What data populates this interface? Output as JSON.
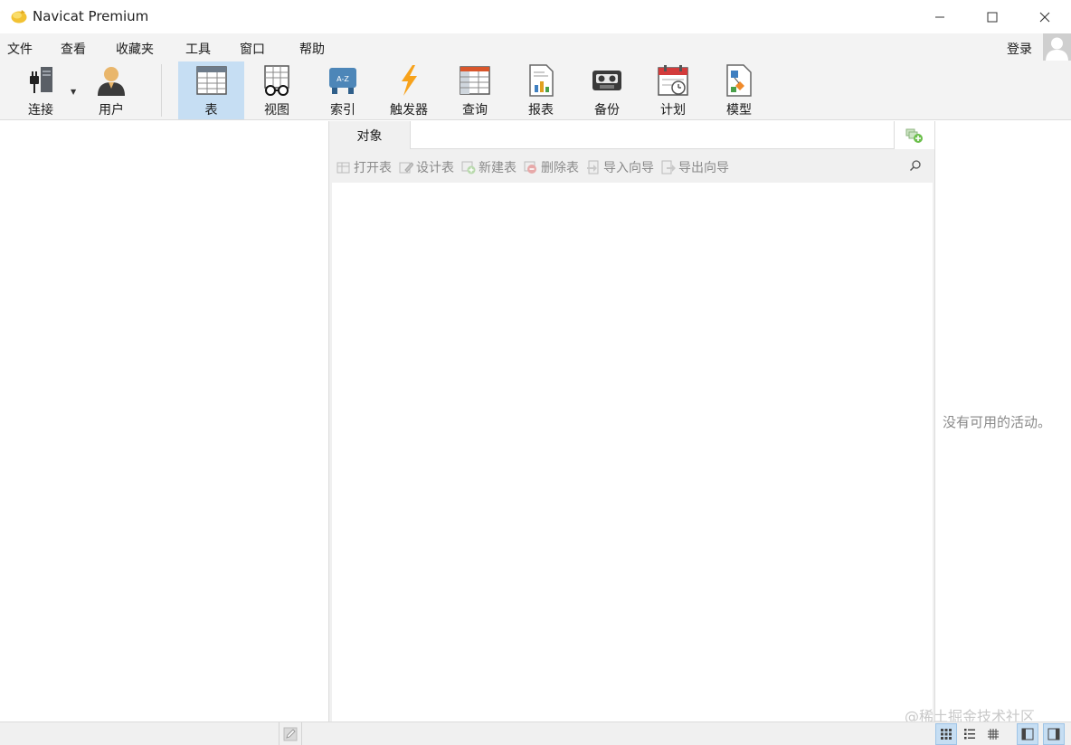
{
  "window": {
    "title": "Navicat Premium",
    "icon": "navicat-logo-icon"
  },
  "menu": {
    "items": [
      "文件",
      "查看",
      "收藏夹",
      "工具",
      "窗口",
      "帮助"
    ],
    "login": "登录"
  },
  "toolbar": {
    "buttons": [
      {
        "label": "连接",
        "icon": "connection-icon"
      },
      {
        "label": "用户",
        "icon": "user-icon"
      },
      {
        "label": "表",
        "icon": "table-icon",
        "active": true
      },
      {
        "label": "视图",
        "icon": "view-icon"
      },
      {
        "label": "索引",
        "icon": "index-icon"
      },
      {
        "label": "触发器",
        "icon": "trigger-icon"
      },
      {
        "label": "查询",
        "icon": "query-icon"
      },
      {
        "label": "报表",
        "icon": "report-icon"
      },
      {
        "label": "备份",
        "icon": "backup-icon"
      },
      {
        "label": "计划",
        "icon": "schedule-icon"
      },
      {
        "label": "模型",
        "icon": "model-icon"
      }
    ]
  },
  "object_panel": {
    "tab": "对象",
    "actions": [
      {
        "label": "打开表",
        "icon": "open-table-icon"
      },
      {
        "label": "设计表",
        "icon": "design-table-icon"
      },
      {
        "label": "新建表",
        "icon": "new-table-icon"
      },
      {
        "label": "删除表",
        "icon": "delete-table-icon"
      },
      {
        "label": "导入向导",
        "icon": "import-wizard-icon"
      },
      {
        "label": "导出向导",
        "icon": "export-wizard-icon"
      }
    ]
  },
  "info_panel": {
    "message": "没有可用的活动。"
  },
  "watermark": "@稀土掘金技术社区",
  "colors": {
    "accent_active": "#c6def3",
    "toolbar_bg": "#f3f3f3",
    "disabled_text": "#8a8a8a"
  }
}
